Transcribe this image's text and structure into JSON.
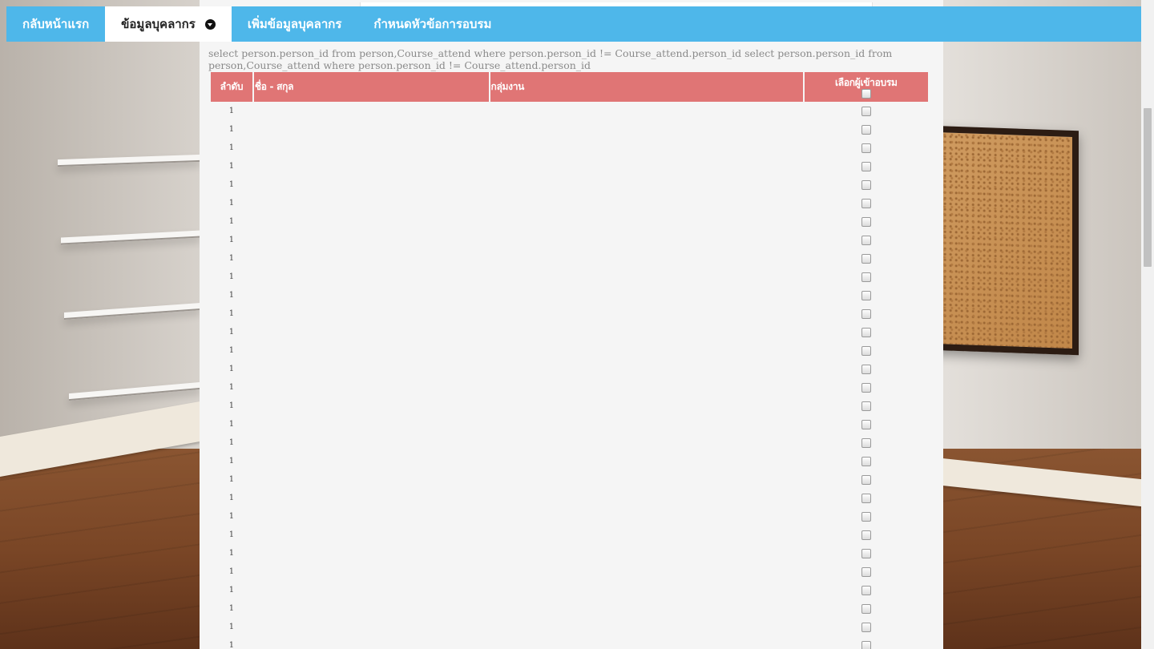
{
  "nav": {
    "items": [
      {
        "label": "กลับหน้าแรก",
        "active": false
      },
      {
        "label": "ข้อมูลบุคลากร",
        "active": true,
        "icon": "chevron-down-circle-icon"
      },
      {
        "label": "เพิ่มข้อมูลบุคลากร",
        "active": false
      },
      {
        "label": "กำหนดหัวข้อการอบรม",
        "active": false
      }
    ]
  },
  "query_text": "select person.person_id from person,Course_attend where person.person_id != Course_attend.person_id select person.person_id from person,Course_attend where person.person_id != Course_attend.person_id",
  "table": {
    "headers": {
      "no": "ลำดับ",
      "name": "ชื่อ - สกุล",
      "group": "กลุ่มงาน",
      "select": "เลือกผู้เข้าอบรม"
    },
    "rows": [
      {
        "no": "1",
        "name": "",
        "group": "",
        "checked": false
      },
      {
        "no": "1",
        "name": "",
        "group": "",
        "checked": false
      },
      {
        "no": "1",
        "name": "",
        "group": "",
        "checked": false
      },
      {
        "no": "1",
        "name": "",
        "group": "",
        "checked": false
      },
      {
        "no": "1",
        "name": "",
        "group": "",
        "checked": false
      },
      {
        "no": "1",
        "name": "",
        "group": "",
        "checked": false
      },
      {
        "no": "1",
        "name": "",
        "group": "",
        "checked": false
      },
      {
        "no": "1",
        "name": "",
        "group": "",
        "checked": false
      },
      {
        "no": "1",
        "name": "",
        "group": "",
        "checked": false
      },
      {
        "no": "1",
        "name": "",
        "group": "",
        "checked": false
      },
      {
        "no": "1",
        "name": "",
        "group": "",
        "checked": false
      },
      {
        "no": "1",
        "name": "",
        "group": "",
        "checked": false
      },
      {
        "no": "1",
        "name": "",
        "group": "",
        "checked": false
      },
      {
        "no": "1",
        "name": "",
        "group": "",
        "checked": false
      },
      {
        "no": "1",
        "name": "",
        "group": "",
        "checked": false
      },
      {
        "no": "1",
        "name": "",
        "group": "",
        "checked": false
      },
      {
        "no": "1",
        "name": "",
        "group": "",
        "checked": false
      },
      {
        "no": "1",
        "name": "",
        "group": "",
        "checked": false
      },
      {
        "no": "1",
        "name": "",
        "group": "",
        "checked": false
      },
      {
        "no": "1",
        "name": "",
        "group": "",
        "checked": false
      },
      {
        "no": "1",
        "name": "",
        "group": "",
        "checked": false
      },
      {
        "no": "1",
        "name": "",
        "group": "",
        "checked": false
      },
      {
        "no": "1",
        "name": "",
        "group": "",
        "checked": false
      },
      {
        "no": "1",
        "name": "",
        "group": "",
        "checked": false
      },
      {
        "no": "1",
        "name": "",
        "group": "",
        "checked": false
      },
      {
        "no": "1",
        "name": "",
        "group": "",
        "checked": false
      },
      {
        "no": "1",
        "name": "",
        "group": "",
        "checked": false
      },
      {
        "no": "1",
        "name": "",
        "group": "",
        "checked": false
      },
      {
        "no": "1",
        "name": "",
        "group": "",
        "checked": false
      },
      {
        "no": "1",
        "name": "",
        "group": "",
        "checked": false
      }
    ]
  },
  "colors": {
    "nav_bg": "#4eb7ea",
    "header_bg": "#e07575",
    "panel_bg": "#f5f5f5"
  }
}
